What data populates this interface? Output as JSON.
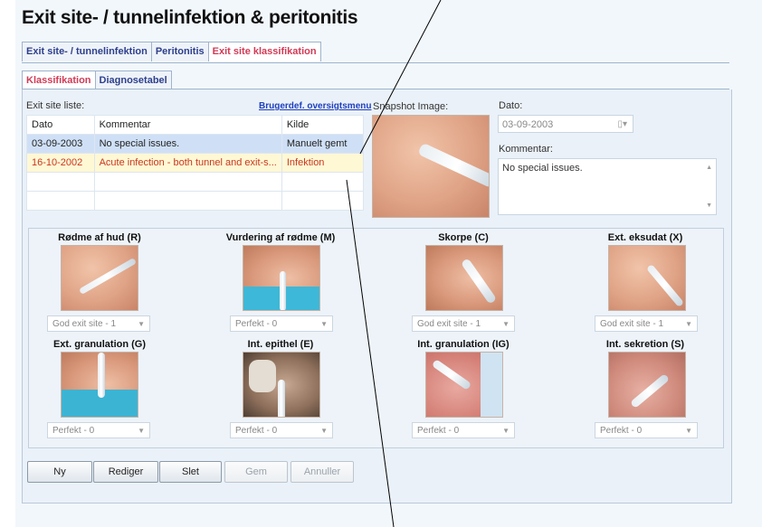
{
  "title": "Exit site- / tunnelinfektion & peritonitis",
  "tabs_top": [
    {
      "label": "Exit site- / tunnelinfektion"
    },
    {
      "label": "Peritonitis"
    },
    {
      "label": "Exit site klassifikation"
    }
  ],
  "tabs_sub": [
    {
      "label": "Klassifikation"
    },
    {
      "label": "Diagnosetabel"
    }
  ],
  "list": {
    "label": "Exit site liste:",
    "menu_link": "Brugerdef. oversigtsmenu",
    "columns": [
      "Dato",
      "Kommentar",
      "Kilde"
    ],
    "rows": [
      {
        "dato": "03-09-2003",
        "kommentar": "No special issues.",
        "kilde": "Manuelt gemt"
      },
      {
        "dato": "16-10-2002",
        "kommentar": "Acute infection - both tunnel and exit-s...",
        "kilde": "Infektion"
      }
    ]
  },
  "snapshot": {
    "label": "Snapshot Image:"
  },
  "dato": {
    "label": "Dato:",
    "value": "03-09-2003"
  },
  "kommentar": {
    "label": "Kommentar:",
    "value": "No special issues."
  },
  "categories": [
    {
      "title": "Rødme af hud (R)",
      "value": "God exit site - 1"
    },
    {
      "title": "Vurdering af rødme (M)",
      "value": "Perfekt - 0"
    },
    {
      "title": "Skorpe (C)",
      "value": "God exit site - 1"
    },
    {
      "title": "Ext. eksudat (X)",
      "value": "God exit site - 1"
    },
    {
      "title": "Ext. granulation (G)",
      "value": "Perfekt - 0"
    },
    {
      "title": "Int. epithel (E)",
      "value": "Perfekt - 0"
    },
    {
      "title": "Int. granulation (IG)",
      "value": "Perfekt - 0"
    },
    {
      "title": "Int. sekretion (S)",
      "value": "Perfekt - 0"
    }
  ],
  "buttons": {
    "new": "Ny",
    "edit": "Rediger",
    "delete": "Slet",
    "save": "Gem",
    "cancel": "Annuller"
  },
  "colors": {
    "active_tab": "#d23a55",
    "tab_text": "#2d3f8c",
    "selected_row": "#cfe0f6",
    "warning_row": "#fff8d5",
    "warning_text": "#c9371f"
  }
}
